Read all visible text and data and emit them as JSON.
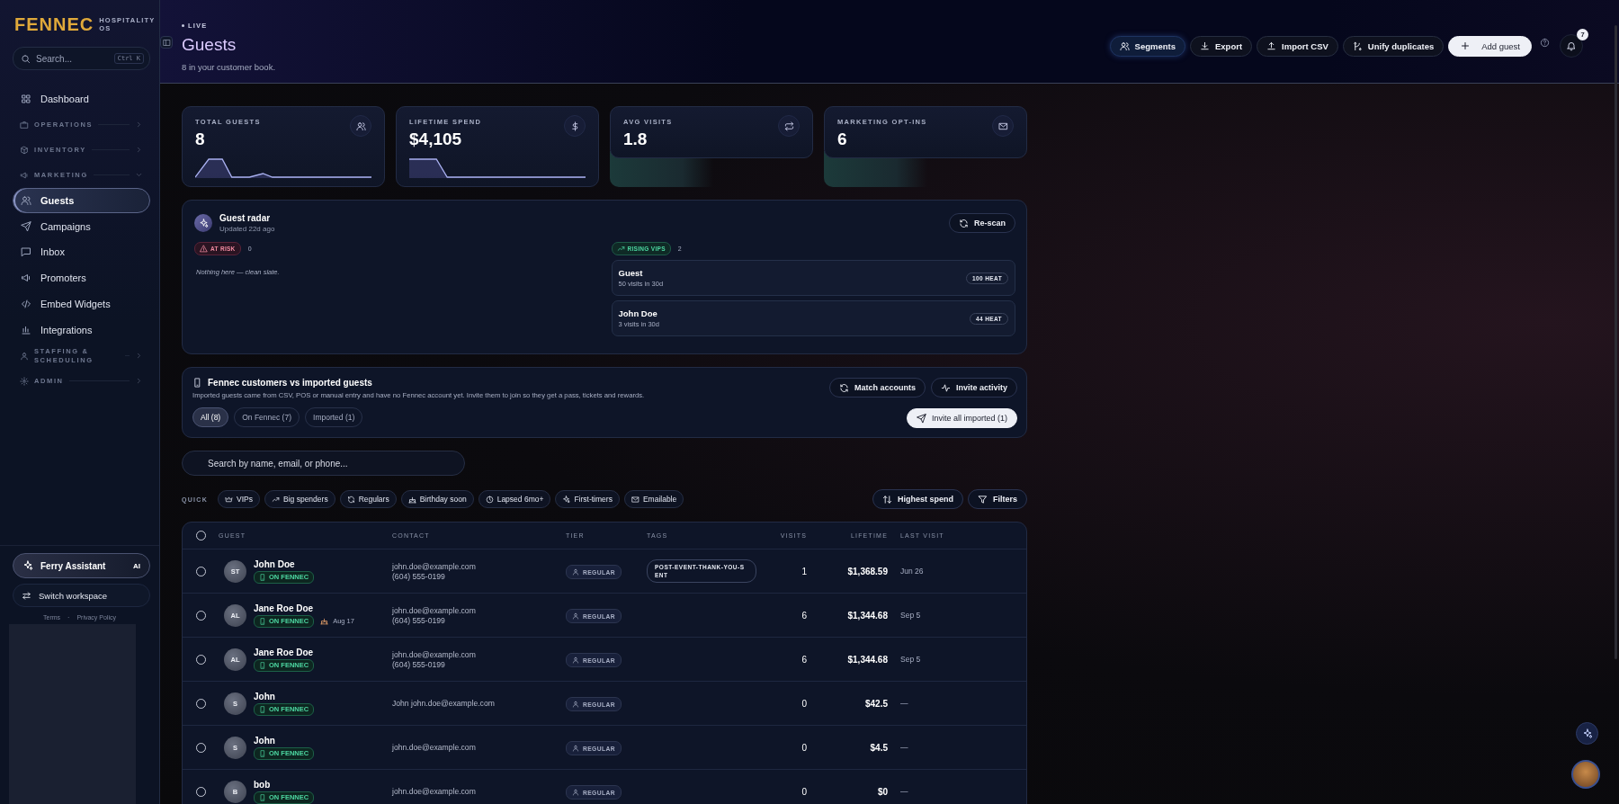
{
  "sidebar": {
    "brand": "FENNEC",
    "brand_sub": "HOSPITALITY OS",
    "search": {
      "placeholder": "Search...",
      "shortcut": "Ctrl K"
    },
    "nav": [
      {
        "kind": "link",
        "label": "Dashboard",
        "selected": false
      },
      {
        "kind": "section",
        "label": "OPERATIONS",
        "expanded": false
      },
      {
        "kind": "section",
        "label": "INVENTORY",
        "expanded": false
      },
      {
        "kind": "section",
        "label": "MARKETING",
        "expanded": true,
        "children": [
          {
            "label": "Guests",
            "selected": true
          },
          {
            "label": "Campaigns",
            "selected": false
          },
          {
            "label": "Inbox",
            "selected": false
          },
          {
            "label": "Promoters",
            "selected": false
          },
          {
            "label": "Embed Widgets",
            "selected": false
          },
          {
            "label": "Integrations",
            "selected": false
          }
        ]
      },
      {
        "kind": "section",
        "label": "STAFFING & SCHEDULING",
        "expanded": false
      },
      {
        "kind": "section",
        "label": "ADMIN",
        "expanded": false
      }
    ],
    "assistant": {
      "label": "Ferry Assistant",
      "badge": "AI"
    },
    "switch": "Switch workspace",
    "links": [
      "Terms",
      "Privacy Policy"
    ],
    "separator": "·"
  },
  "header": {
    "live": "LIVE",
    "title": "Guests",
    "subtitle": "8 in your customer book.",
    "actions": [
      {
        "label": "Segments",
        "kind": "outline",
        "selected": true
      },
      {
        "label": "Export",
        "kind": "outline",
        "selected": false
      },
      {
        "label": "Import CSV",
        "kind": "outline",
        "selected": false
      },
      {
        "label": "Unify duplicates",
        "kind": "outline",
        "selected": false
      },
      {
        "label": "Add guest",
        "kind": "primary",
        "selected": false
      }
    ],
    "notifications": "7"
  },
  "stats": [
    {
      "label": "TOTAL GUESTS",
      "value": "8",
      "kind": "sparkline"
    },
    {
      "label": "LIFETIME SPEND",
      "value": "$4,105",
      "kind": "sparkline"
    },
    {
      "label": "AVG VISITS",
      "value": "1.8",
      "kind": "faded"
    },
    {
      "label": "MARKETING OPT-INS",
      "value": "6",
      "kind": "faded"
    }
  ],
  "radar": {
    "title": "Guest radar",
    "updated": "Updated 22d ago",
    "rescan": "Re-scan",
    "at_risk": {
      "label": "AT RISK",
      "count": "0",
      "empty": "Nothing here — clean slate."
    },
    "rising": {
      "label": "RISING VIPS",
      "count": "2",
      "items": [
        {
          "name": "Guest",
          "detail": "50 visits in 30d",
          "heat": "100 HEAT"
        },
        {
          "name": "John Doe",
          "detail": "3 visits in 30d",
          "heat": "44 HEAT"
        }
      ]
    }
  },
  "imports": {
    "title": "Fennec customers vs imported guests",
    "description": "Imported guests came from CSV, POS or manual entry and have no Fennec account yet. Invite them to join so they get a pass, tickets and rewards.",
    "tabs": [
      {
        "label": "All (8)",
        "selected": true
      },
      {
        "label": "On Fennec (7)",
        "selected": false
      },
      {
        "label": "Imported (1)",
        "selected": false
      }
    ],
    "actions": [
      "Match accounts",
      "Invite activity"
    ],
    "invite": "Invite all imported (1)"
  },
  "search": {
    "placeholder": "Search by name, email, or phone..."
  },
  "quick": {
    "label": "QUICK",
    "chips": [
      "VIPs",
      "Big spenders",
      "Regulars",
      "Birthday soon",
      "Lapsed 6mo+",
      "First-timers",
      "Emailable"
    ],
    "sort": "Highest spend",
    "filters": "Filters"
  },
  "table": {
    "select_all": {
      "checked": false
    },
    "columns": [
      "GUEST",
      "CONTACT",
      "TIER",
      "TAGS",
      "VISITS",
      "LIFETIME",
      "LAST VISIT"
    ],
    "rows": [
      {
        "checked": false,
        "initials": "ST",
        "name": "John Doe",
        "status": "ON FENNEC",
        "contact": [
          "john.doe@example.com",
          "(604) 555-0199"
        ],
        "tier": "REGULAR",
        "tags": [
          "POST-EVENT-THANK-YOU-SENT"
        ],
        "visits": "1",
        "lifetime": "$1,368.59",
        "last_visit": "Jun 26"
      },
      {
        "checked": false,
        "initials": "AL",
        "name": "Jane Roe Doe",
        "status": "ON FENNEC",
        "birthday": "Aug 17",
        "contact": [
          "john.doe@example.com",
          "(604) 555-0199"
        ],
        "tier": "REGULAR",
        "visits": "6",
        "lifetime": "$1,344.68",
        "last_visit": "Sep 5"
      },
      {
        "checked": false,
        "initials": "AL",
        "name": "Jane Roe Doe",
        "status": "ON FENNEC",
        "contact": [
          "john.doe@example.com",
          "(604) 555-0199"
        ],
        "tier": "REGULAR",
        "visits": "6",
        "lifetime": "$1,344.68",
        "last_visit": "Sep 5"
      },
      {
        "checked": false,
        "initials": "S",
        "name": "John",
        "status": "ON FENNEC",
        "contact": [
          "John john.doe@example.com"
        ],
        "tier": "REGULAR",
        "visits": "0",
        "lifetime": "$42.5",
        "last_visit": "—"
      },
      {
        "checked": false,
        "initials": "S",
        "name": "John",
        "status": "ON FENNEC",
        "contact": [
          "john.doe@example.com"
        ],
        "tier": "REGULAR",
        "visits": "0",
        "lifetime": "$4.5",
        "last_visit": "—"
      },
      {
        "checked": false,
        "initials": "B",
        "name": "bob",
        "status": "ON FENNEC",
        "contact": [
          "john.doe@example.com"
        ],
        "tier": "REGULAR",
        "visits": "0",
        "lifetime": "$0",
        "last_visit": "—"
      }
    ]
  }
}
